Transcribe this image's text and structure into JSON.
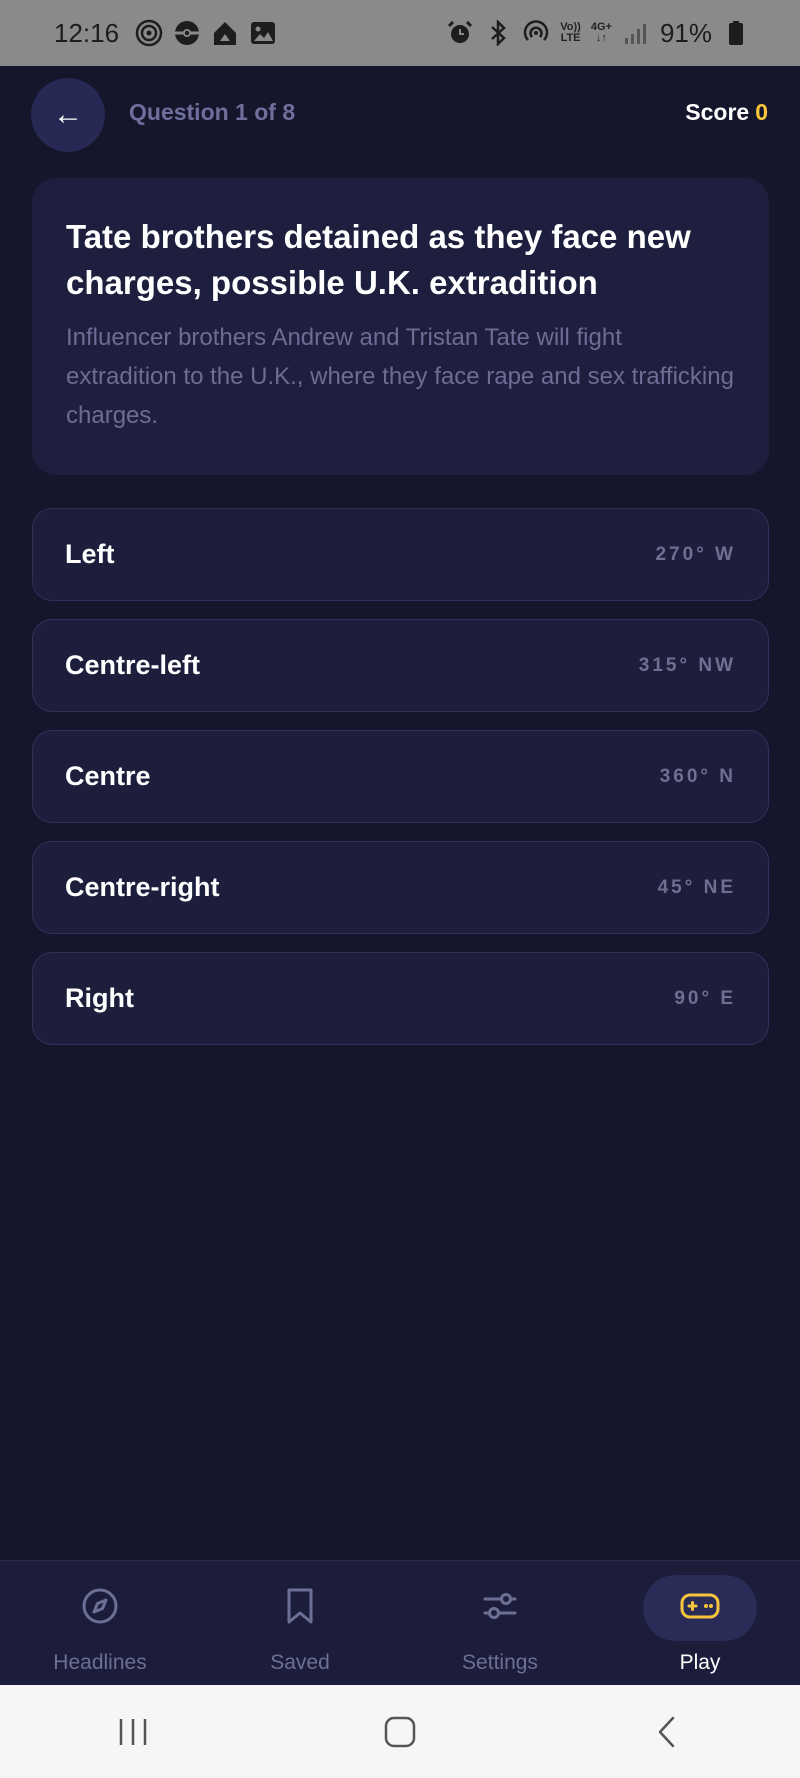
{
  "status_bar": {
    "time": "12:16",
    "battery": "91%",
    "network_top": "Vo))",
    "network_bottom": "LTE",
    "data_top": "4G+",
    "data_bottom": "↓↑"
  },
  "header": {
    "question_label": "Question 1 of 8",
    "score_label": "Score",
    "score_value": "0",
    "back_symbol": "←"
  },
  "headline": {
    "title": "Tate brothers detained as they face new charges, possible U.K. extradition",
    "description": "Influencer brothers Andrew and Tristan Tate will fight extradition to the U.K., where they face rape and sex trafficking charges."
  },
  "options": [
    {
      "label": "Left",
      "degree": "270° W"
    },
    {
      "label": "Centre-left",
      "degree": "315° NW"
    },
    {
      "label": "Centre",
      "degree": "360° N"
    },
    {
      "label": "Centre-right",
      "degree": "45° NE"
    },
    {
      "label": "Right",
      "degree": "90° E"
    }
  ],
  "bottom_nav": [
    {
      "label": "Headlines",
      "icon": "compass-icon",
      "active": false
    },
    {
      "label": "Saved",
      "icon": "bookmark-icon",
      "active": false
    },
    {
      "label": "Settings",
      "icon": "sliders-icon",
      "active": false
    },
    {
      "label": "Play",
      "icon": "gamepad-icon",
      "active": true
    }
  ],
  "colors": {
    "background": "#15162b",
    "card": "#1e1f3e",
    "accent_score": "#f7c53c",
    "muted_text": "#6e6f9c"
  }
}
